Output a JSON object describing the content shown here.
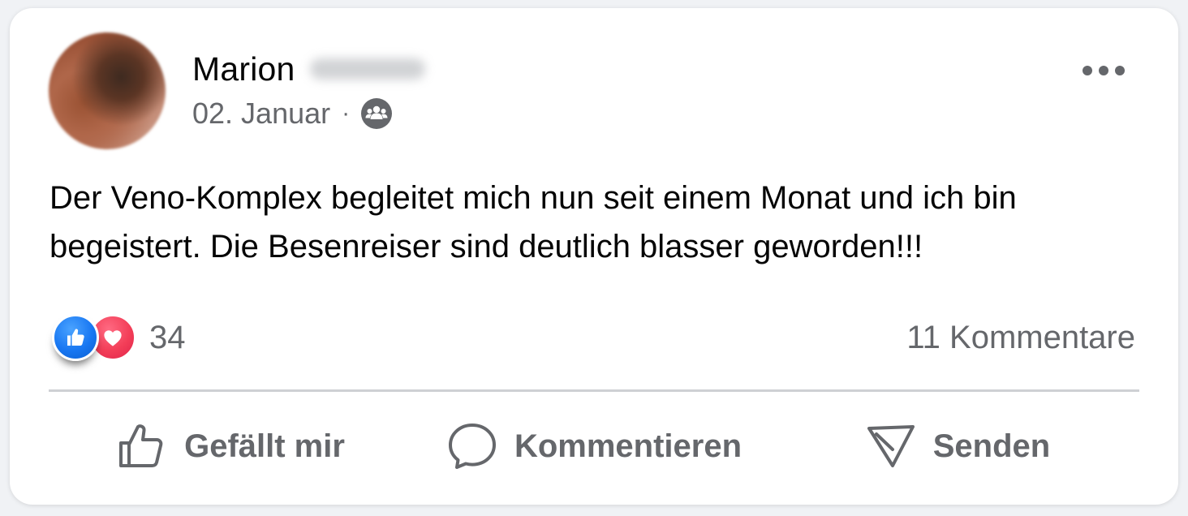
{
  "post": {
    "author_name": "Marion",
    "date": "02. Januar",
    "separator": "·",
    "audience_icon": "friends-icon",
    "more_icon": "more-options-icon",
    "text": "Der Veno-Komplex begleitet mich nun seit einem Monat und ich bin begeistert. Die Besenreiser sind deutlich blasser geworden!!!"
  },
  "engagement": {
    "reaction_icons": [
      "like-reaction-icon",
      "love-reaction-icon"
    ],
    "reaction_count": "34",
    "comments_label": "11 Kommentare"
  },
  "actions": {
    "like_label": "Gefällt mir",
    "comment_label": "Kommentieren",
    "send_label": "Senden"
  },
  "colors": {
    "background": "#f0f2f5",
    "card": "#ffffff",
    "text_primary": "#050505",
    "text_secondary": "#65676b",
    "like_blue": "#1877f2",
    "love_red": "#f33e58",
    "divider": "#ced0d4"
  }
}
